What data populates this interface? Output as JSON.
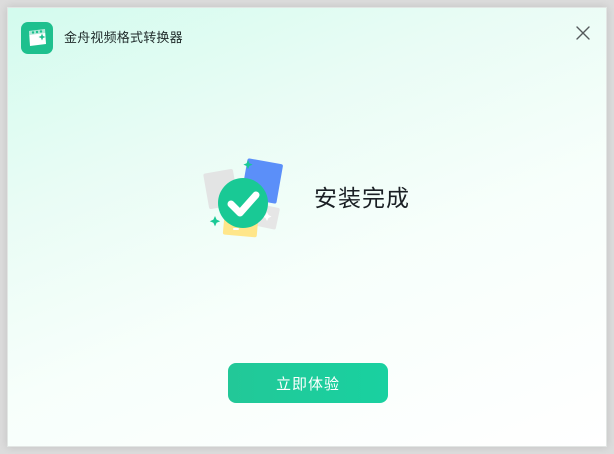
{
  "window": {
    "title": "金舟视频格式转换器",
    "logo_icon": "app-logo-icon",
    "close_icon": "close-icon"
  },
  "main": {
    "status_icon": "checkmark-success-icon",
    "status_text": "安装完成",
    "action_button_label": "立即体验"
  },
  "colors": {
    "accent": "#1ec08e",
    "button_start": "#22c898",
    "button_end": "#19d1a0",
    "check_circle": "#19c995",
    "card_blue": "#5b8ff9",
    "card_yellow": "#ffe68a",
    "card_gray": "#e6e6e6"
  }
}
